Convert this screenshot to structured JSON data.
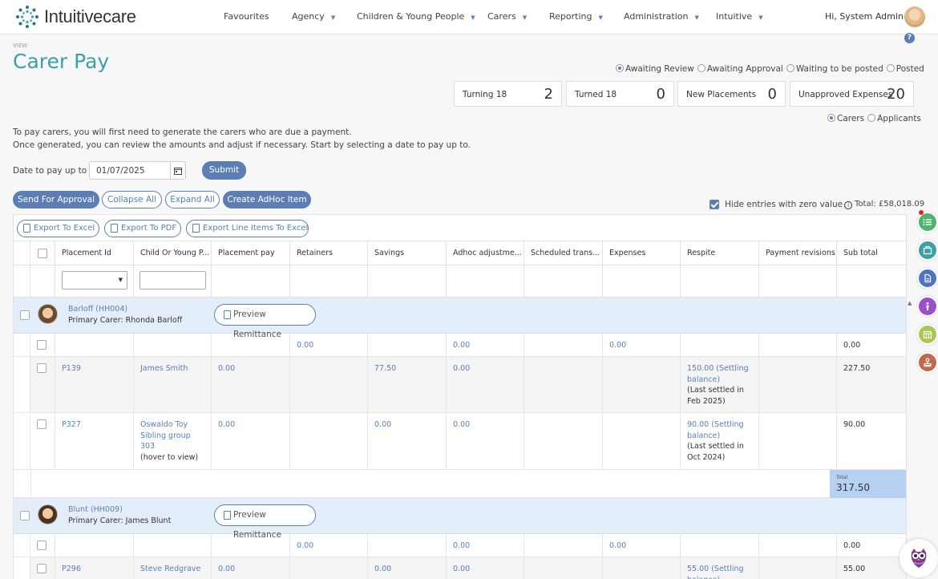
{
  "brand": {
    "name": "Intuitivecare"
  },
  "nav": {
    "items": [
      {
        "label": "Favourites",
        "dropdown": false
      },
      {
        "label": "Agency",
        "dropdown": true
      },
      {
        "label": "Children & Young People",
        "dropdown": true
      },
      {
        "label": "Carers",
        "dropdown": true
      },
      {
        "label": "Reporting",
        "dropdown": true
      },
      {
        "label": "Administration",
        "dropdown": true
      },
      {
        "label": "Intuitive",
        "dropdown": true
      }
    ],
    "greeting": "Hi, System Admin"
  },
  "page": {
    "view_label": "VIEW",
    "title": "Carer Pay",
    "status_filters": [
      {
        "label": "Awaiting Review",
        "selected": true
      },
      {
        "label": "Awaiting Approval",
        "selected": false
      },
      {
        "label": "Waiting to be posted",
        "selected": false
      },
      {
        "label": "Posted",
        "selected": false
      }
    ],
    "stats": [
      {
        "label": "Turning 18",
        "value": "2"
      },
      {
        "label": "Turned 18",
        "value": "0"
      },
      {
        "label": "New Placements",
        "value": "0"
      },
      {
        "label": "Unapproved Expenses",
        "value": "20"
      }
    ],
    "type_filters": [
      {
        "label": "Carers",
        "selected": true
      },
      {
        "label": "Applicants",
        "selected": false
      }
    ],
    "intro_lines": [
      "To pay carers, you will first need to generate the carers who are due a payment.",
      "Once generated, you can review the amounts and adjust if necessary. Start by selecting a date to pay up to."
    ],
    "date_label": "Date to pay up to",
    "date_value": "01/07/2025",
    "submit_label": "Submit",
    "actions": {
      "send": "Send For Approval",
      "collapse": "Collapse All",
      "expand": "Expand All",
      "adhoc": "Create AdHoc Item"
    },
    "hide_zero_label": "Hide entries with zero value",
    "hide_zero_checked": true,
    "total_label": "Total: £58,018.09"
  },
  "exports": [
    "Export To Excel",
    "Export To PDF",
    "Export Line Items To Excel"
  ],
  "columns": [
    "Placement Id",
    "Child Or Young P...",
    "Placement pay",
    "Retainers",
    "Savings",
    "Adhoc adjustme...",
    "Scheduled trans...",
    "Expenses",
    "Respite",
    "Payment revisions",
    "Sub total"
  ],
  "groups": [
    {
      "name": "Barloff (HH004)",
      "primary": "Primary Carer: Rhonda Barloff",
      "preview_label": "Preview Remittance",
      "summary": {
        "retainers": "0.00",
        "adhoc": "0.00",
        "expenses": "0.00",
        "subtotal": "0.00"
      },
      "rows": [
        {
          "placement": "P139",
          "child": "James Smith",
          "child_note": "",
          "pay": "0.00",
          "savings": "77.50",
          "adhoc": "0.00",
          "respite_link": "150.00 (Settling balance)",
          "respite_note": "(Last settled in Feb 2025)",
          "subtotal": "227.50"
        },
        {
          "placement": "P327",
          "child": "Oswaldo Toy Sibling group 303",
          "child_note": "(hover to view)",
          "pay": "0.00",
          "savings": "0.00",
          "adhoc": "0.00",
          "respite_link": "90.00 (Settling balance)",
          "respite_note": "(Last settled in Oct 2024)",
          "subtotal": "90.00"
        }
      ],
      "total_label": "Total",
      "total_value": "317.50"
    },
    {
      "name": "Blunt (HH009)",
      "primary": "Primary Carer: James Blunt",
      "preview_label": "Preview Remittance",
      "summary": {
        "retainers": "0.00",
        "adhoc": "0.00",
        "expenses": "0.00",
        "subtotal": "0.00"
      },
      "rows": [
        {
          "placement": "P296",
          "child": "Steve Redgrave",
          "child_note": "",
          "pay": "0.00",
          "savings": "0.00",
          "adhoc": "0.00",
          "respite_link": "55.00 (Settling balance)",
          "respite_note": "",
          "subtotal": "55.00"
        }
      ]
    }
  ],
  "colors": {
    "accent": "#5b7fb5",
    "title": "#3aa1a6",
    "group_bg": "#e4eefb",
    "total_bg": "#b6d0f1"
  }
}
